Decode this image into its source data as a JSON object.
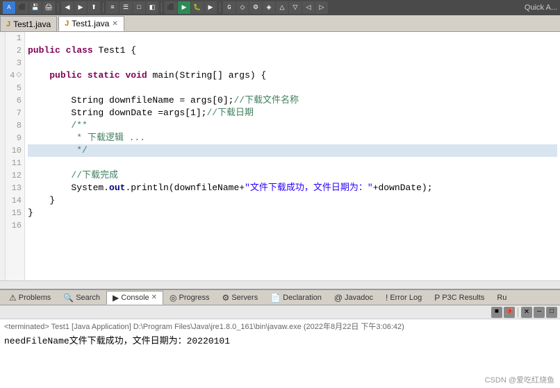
{
  "toolbar": {
    "quickAccess": "Quick A..."
  },
  "tabs": [
    {
      "label": "Test1.java",
      "icon": "J",
      "active": false,
      "closable": false
    },
    {
      "label": "Test1.java",
      "icon": "J",
      "active": true,
      "closable": true
    }
  ],
  "editor": {
    "lines": [
      {
        "num": 1,
        "code": "",
        "highlight": false,
        "arrow": false
      },
      {
        "num": 2,
        "code": "public class Test1 {",
        "highlight": false,
        "arrow": false
      },
      {
        "num": 3,
        "code": "",
        "highlight": false,
        "arrow": false
      },
      {
        "num": 4,
        "code": "    public static void main(String[] args) {",
        "highlight": false,
        "arrow": true
      },
      {
        "num": 5,
        "code": "",
        "highlight": false,
        "arrow": false
      },
      {
        "num": 6,
        "code": "        String downfileName = args[0];//下载文件名称",
        "highlight": false,
        "arrow": false
      },
      {
        "num": 7,
        "code": "        String downDate =args[1];//下载日期",
        "highlight": false,
        "arrow": false
      },
      {
        "num": 8,
        "code": "        /**",
        "highlight": false,
        "arrow": false
      },
      {
        "num": 9,
        "code": "         * 下载逻辑 ...",
        "highlight": false,
        "arrow": false
      },
      {
        "num": 10,
        "code": "         */",
        "highlight": true,
        "arrow": false
      },
      {
        "num": 11,
        "code": "",
        "highlight": false,
        "arrow": false
      },
      {
        "num": 12,
        "code": "        //下载完成",
        "highlight": false,
        "arrow": false
      },
      {
        "num": 13,
        "code": "        System.out.println(downfileName+\"文件下载成功，文件日期为：\"+downDate);",
        "highlight": false,
        "arrow": false
      },
      {
        "num": 14,
        "code": "    }",
        "highlight": false,
        "arrow": false
      },
      {
        "num": 15,
        "code": "}",
        "highlight": false,
        "arrow": false
      },
      {
        "num": 16,
        "code": "",
        "highlight": false,
        "arrow": false
      }
    ]
  },
  "bottomTabs": [
    {
      "label": "Problems",
      "icon": "⚠",
      "active": false
    },
    {
      "label": "Search",
      "icon": "🔍",
      "active": false
    },
    {
      "label": "Console",
      "icon": "▶",
      "active": true
    },
    {
      "label": "Progress",
      "icon": "◎",
      "active": false
    },
    {
      "label": "Servers",
      "icon": "⚙",
      "active": false
    },
    {
      "label": "Declaration",
      "icon": "D",
      "active": false
    },
    {
      "label": "Javadoc",
      "icon": "@",
      "active": false
    },
    {
      "label": "Error Log",
      "icon": "!",
      "active": false
    },
    {
      "label": "P3C Results",
      "icon": "P",
      "active": false
    },
    {
      "label": "Ru",
      "icon": "",
      "active": false
    }
  ],
  "console": {
    "header": "<terminated> Test1 [Java Application] D:\\Program Files\\Java\\jre1.8.0_161\\bin\\javaw.exe (2022年8月22日 下午3:06:42)",
    "output": "needFileName文件下载成功，文件日期为：20220101"
  },
  "watermark": "CSDN @爱吃红烧鱼"
}
